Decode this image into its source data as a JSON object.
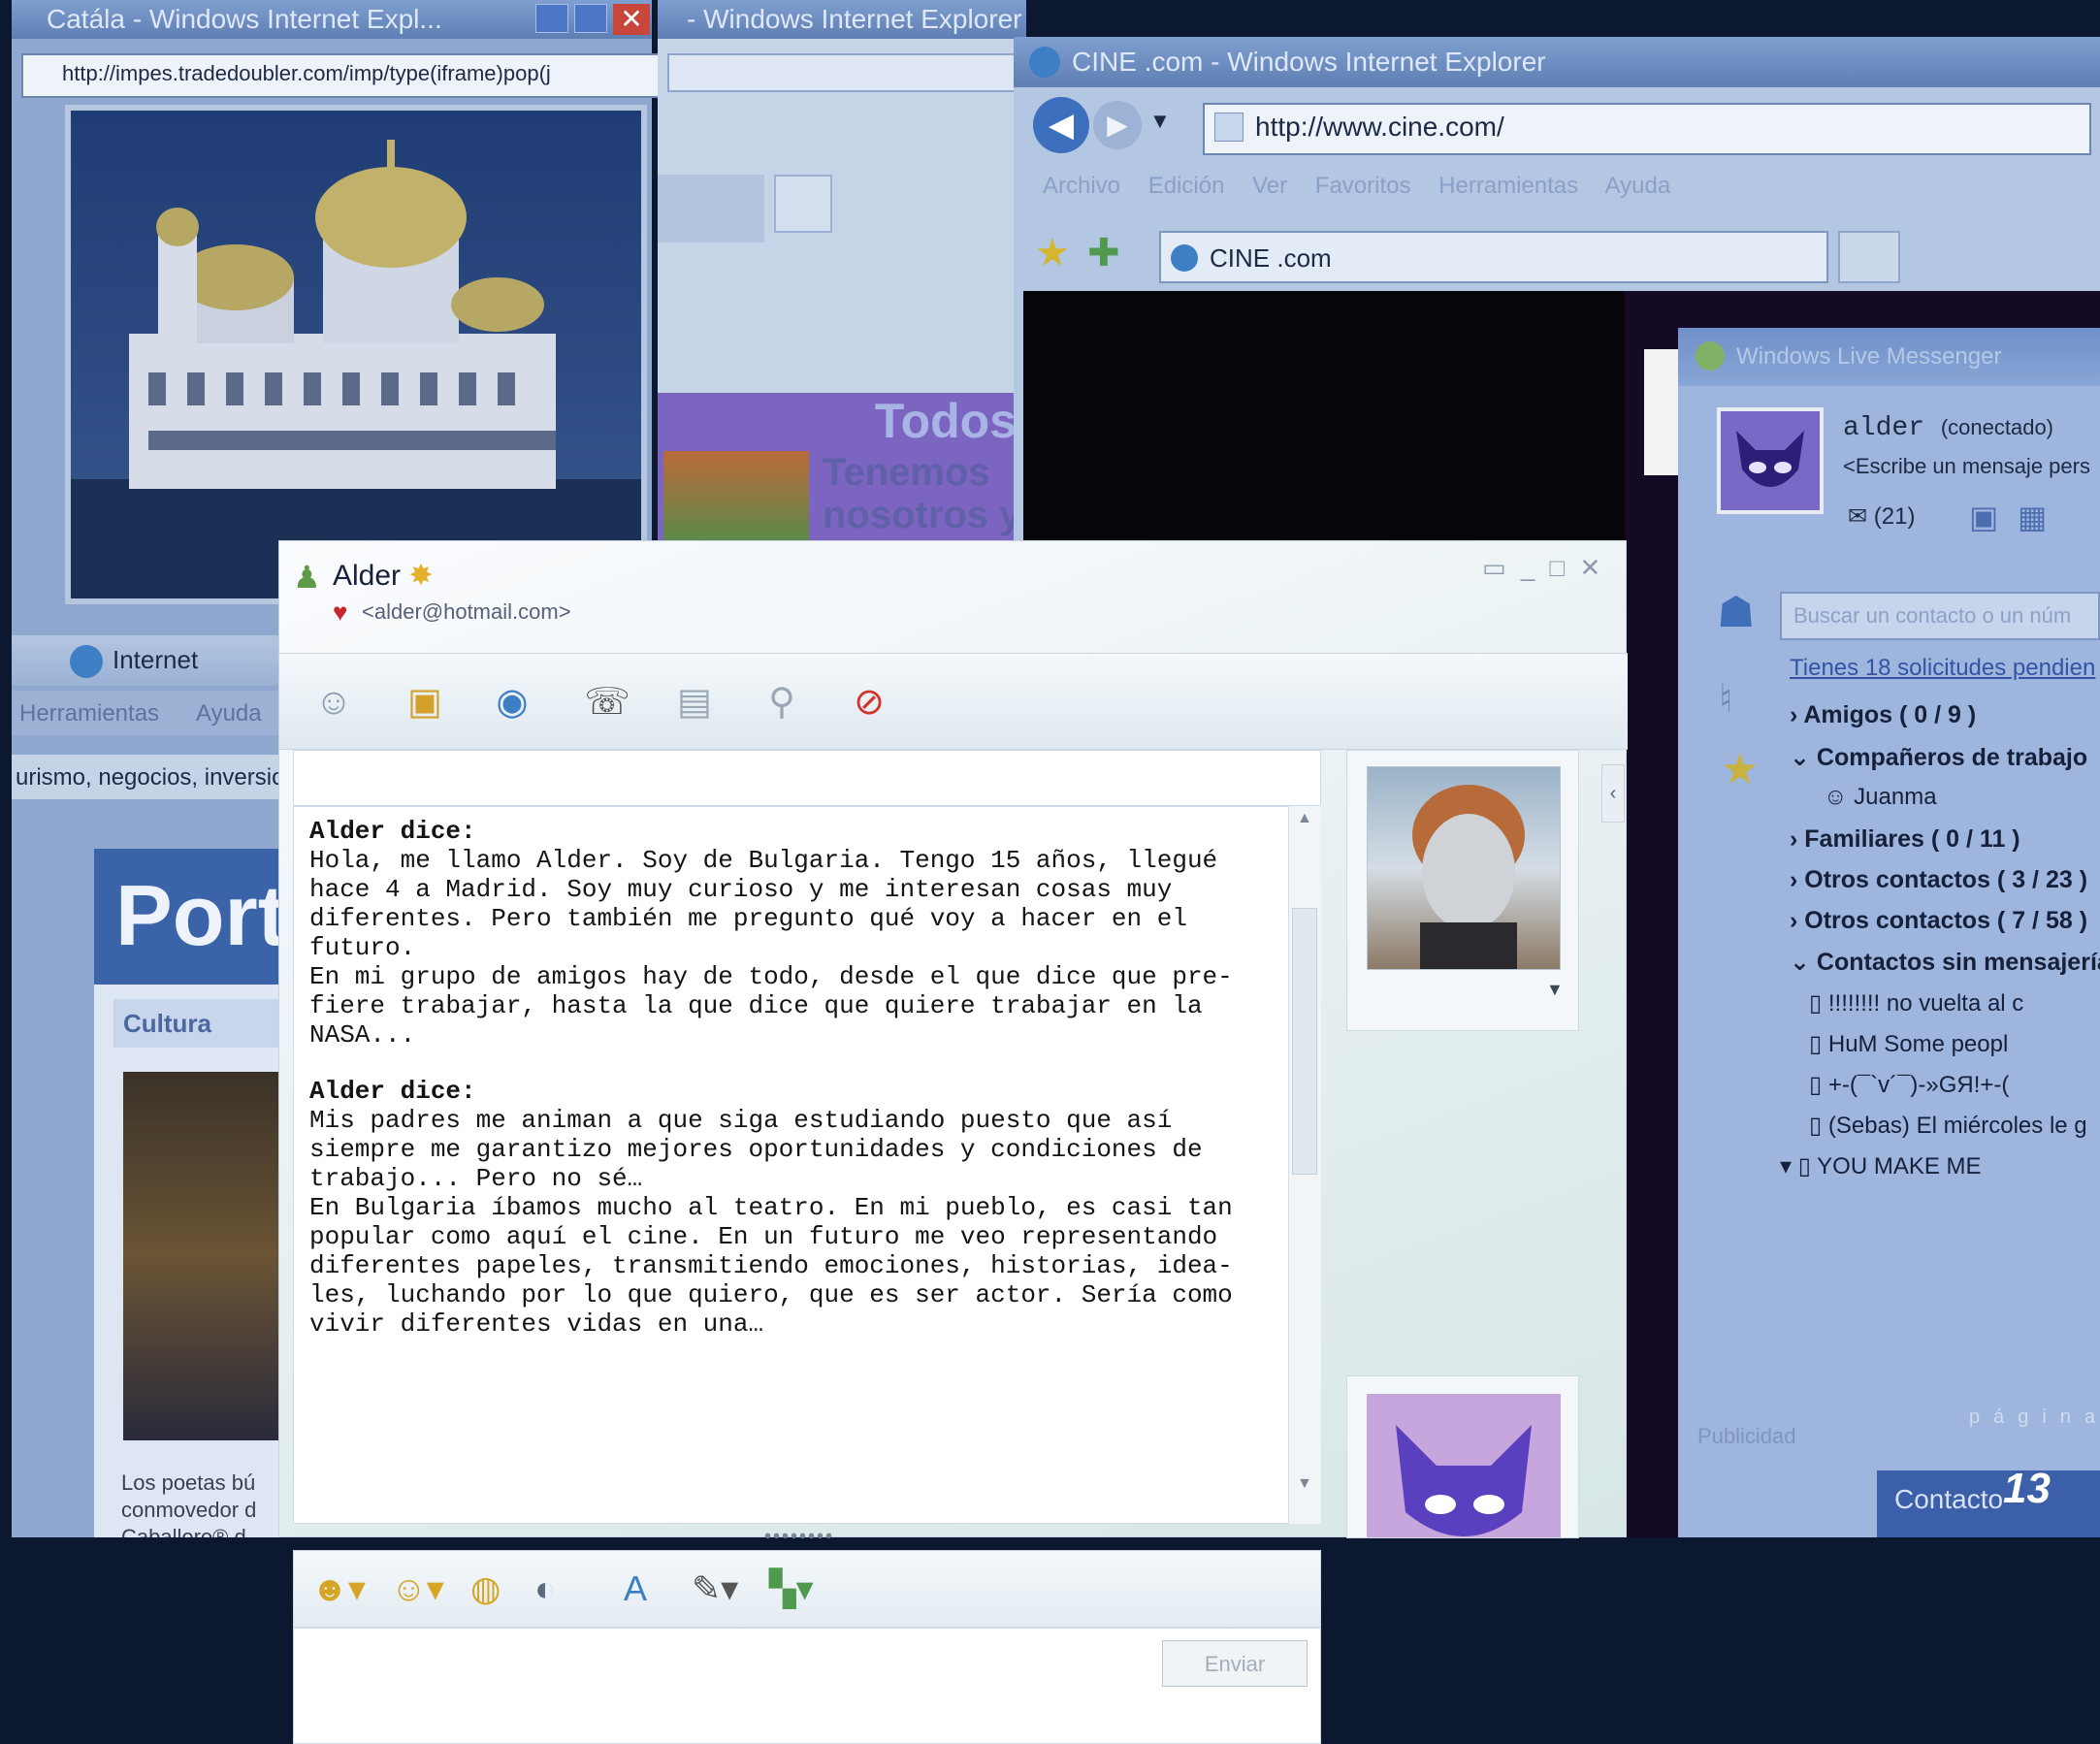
{
  "popup_window": {
    "title": "Catála - Windows Internet Expl...",
    "address": "http://impes.tradedoubler.com/imp/type(iframe)pop(j",
    "status_zone": "Internet",
    "menu": [
      "Herramientas",
      "Ayuda"
    ],
    "tagline": "urismo, negocios, inversion",
    "portal_title": "Port",
    "portal_section": "Cultura",
    "portal_footer": "Los poetas bú conmovedor d Caballero® d"
  },
  "middle_window": {
    "title": "- Windows Internet Explorer",
    "banner_title": "Todos",
    "banner_sub": "Tenemos nosotros y"
  },
  "cine_window": {
    "title": "CINE .com - Windows Internet Explorer",
    "address": "http://www.cine.com/",
    "menu": [
      "Archivo",
      "Edición",
      "Ver",
      "Favoritos",
      "Herramientas",
      "Ayuda"
    ],
    "tab_label": "CINE .com"
  },
  "contacts_window": {
    "title": "Windows Live Messenger",
    "user_name": "alder",
    "user_state": "(conectado)",
    "personal_message_placeholder": "<Escribe un mensaje pers",
    "inbox_count": "(21)",
    "search_placeholder": "Buscar un contacto o un núm",
    "requests_link": "Tienes 18 solicitudes pendien",
    "groups": [
      {
        "label": "Amigos ( 0 / 9 )"
      },
      {
        "label": "Compañeros de trabajo"
      },
      {
        "label": "Familiares ( 0 / 11 )"
      },
      {
        "label": "Otros contactos ( 3 / 23 )"
      },
      {
        "label": "Otros contactos ( 7 / 58 )"
      },
      {
        "label": "Contactos sin mensajería"
      }
    ],
    "contacts": [
      "Juanma",
      "!!!!!!!! no vuelta al c",
      "HuM Some peopl",
      "+-(¯`v´¯)-»GЯ!+-(",
      "(Sebas) El miércoles le g",
      "YOU MAKE ME"
    ],
    "footer_link": "Publicidad",
    "bottom_button": "Contacto"
  },
  "chat_window": {
    "contact_name": "Alder",
    "contact_email": "<alder@hotmail.com>",
    "send_label": "Enviar",
    "messages": [
      {
        "speaker": "Alder dice:",
        "lines": [
          "Hola, me llamo Alder. Soy de Bulgaria. Tengo 15 años, llegué",
          "hace 4 a Madrid. Soy muy curioso y me interesan cosas muy",
          "diferentes. Pero también me pregunto qué voy a hacer en el",
          "futuro.",
          "En mi grupo de amigos hay de todo, desde el que dice que pre-",
          "fiere trabajar, hasta la que dice que quiere trabajar en la",
          "NASA..."
        ]
      },
      {
        "speaker": "Alder dice:",
        "lines": [
          "Mis padres me animan a que siga estudiando puesto que así",
          "siempre me garantizo mejores oportunidades y condiciones de",
          "trabajo... Pero no sé…",
          "En Bulgaria íbamos mucho al teatro. En mi pueblo, es casi tan",
          "popular como aquí el cine. En un futuro me veo representando",
          "diferentes papeles, transmitiendo emociones, historias, idea-",
          "les, luchando por lo que quiero, que es ser actor. Sería como",
          "vivir diferentes vidas en una…"
        ]
      }
    ],
    "toolbar_icons": [
      "invite-contact-icon",
      "share-files-icon",
      "video-call-icon",
      "call-icon",
      "activities-icon",
      "games-icon",
      "block-contact-icon"
    ],
    "format_icons": [
      "emoticon-icon",
      "wink-icon",
      "nudge-icon",
      "voice-clip-icon",
      "font-icon",
      "background-icon",
      "scene-icon"
    ]
  },
  "page": {
    "label": "página",
    "number": "13"
  },
  "colors": {
    "desktop": "#0b1830",
    "titlebar": "#6f8fc4",
    "chat_background": "#eef4f4",
    "msn_purple": "#7a68c6"
  }
}
